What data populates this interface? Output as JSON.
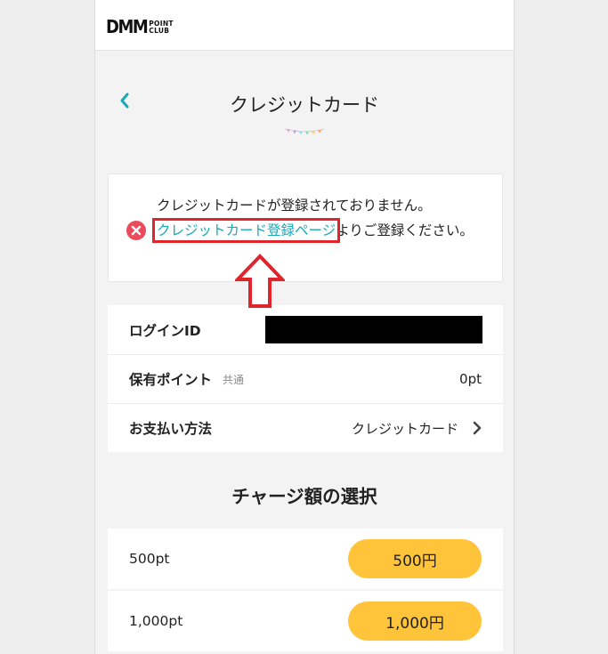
{
  "logo": {
    "main": "DMM",
    "sub_top": "POINT",
    "sub_bottom": "CLUB"
  },
  "header": {
    "title": "クレジットカード"
  },
  "alert": {
    "line1": "クレジットカードが登録されておりません。",
    "link_text": "クレジットカード登録ページ",
    "line2_rest": "よりご登録ください。"
  },
  "account": {
    "login_label": "ログインID",
    "points_label": "保有ポイント",
    "points_sub": "共通",
    "points_value": "0pt",
    "payment_label": "お支払い方法",
    "payment_value": "クレジットカード"
  },
  "charge": {
    "title": "チャージ額の選択",
    "options": [
      {
        "label": "500pt",
        "button": "500円"
      },
      {
        "label": "1,000pt",
        "button": "1,000円"
      }
    ]
  },
  "colors": {
    "accent": "#17a9b6",
    "highlight": "#e0242b",
    "button": "#ffc43a",
    "error": "#ec4b5c"
  }
}
